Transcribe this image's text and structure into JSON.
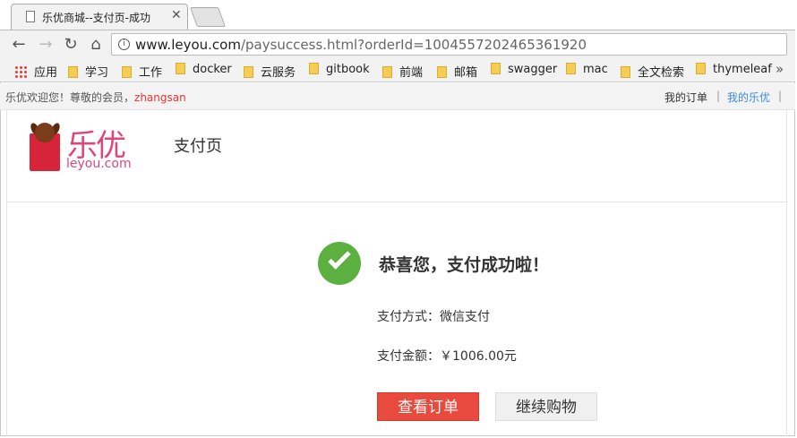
{
  "browser": {
    "tab_title": "乐优商城--支付页-成功",
    "close_glyph": "✕",
    "url_host": "www.leyou.com",
    "url_rest": "/paysuccess.html?orderId=1004557202465361920"
  },
  "bookmarks": [
    {
      "label": "应用",
      "icon": "apps-icon"
    },
    {
      "label": "学习",
      "icon": "folder-icon"
    },
    {
      "label": "工作",
      "icon": "folder-icon"
    },
    {
      "label": "docker",
      "icon": "folder-icon"
    },
    {
      "label": "云服务",
      "icon": "folder-icon"
    },
    {
      "label": "gitbook",
      "icon": "folder-icon"
    },
    {
      "label": "前端",
      "icon": "folder-icon"
    },
    {
      "label": "邮箱",
      "icon": "folder-icon"
    },
    {
      "label": "swagger",
      "icon": "folder-icon"
    },
    {
      "label": "mac",
      "icon": "folder-icon"
    },
    {
      "label": "全文检索",
      "icon": "folder-icon"
    },
    {
      "label": "thymeleaf",
      "icon": "folder-icon"
    }
  ],
  "userbar": {
    "welcome": "乐优欢迎您！尊敬的会员，",
    "username": "zhangsan",
    "my_orders": "我的订单",
    "my_leyou": "我的乐优",
    "separator": "|"
  },
  "header": {
    "logo_cn": "乐优",
    "logo_en": "leyou.com",
    "page_label": "支付页"
  },
  "success": {
    "title": "恭喜您，支付成功啦！",
    "pay_method_label": "支付方式：",
    "pay_method_value": "微信支付",
    "amount_label": "支付金额：",
    "amount_value": "￥1006.00元",
    "view_order_button": "查看订单",
    "continue_shopping_button": "继续购物"
  },
  "colors": {
    "primary_button": "#e84a3d",
    "success_icon": "#5cb03f",
    "brand_pink": "#e0457a",
    "username_red": "#e33",
    "link_blue": "#3a8be0"
  }
}
